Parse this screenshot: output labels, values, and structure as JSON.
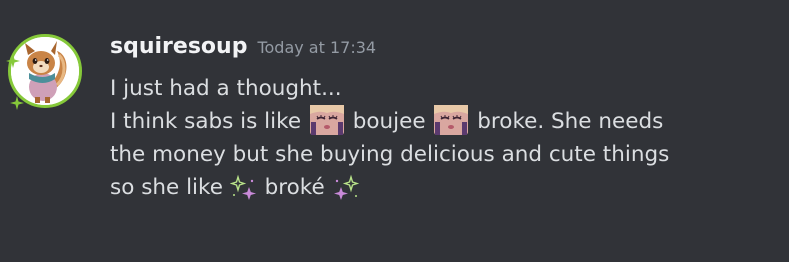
{
  "message": {
    "username": "squiresoup",
    "timestamp": "Today at 17:34",
    "accent_color": "#86c93a",
    "lines": [
      {
        "text": "I just had a thought..."
      },
      {
        "seg1": "I think sabs is like",
        "seg2": "boujee",
        "seg3": "broke. She needs"
      },
      {
        "text": "the money but she buying delicious and cute things"
      },
      {
        "seg1": "so she like",
        "seg2": "broké"
      }
    ],
    "emojis": {
      "face_emoji_1": "crying-face-emoji",
      "face_emoji_2": "crying-face-emoji",
      "sparkle_left": "sparkle-emoji",
      "sparkle_right": "sparkle-emoji"
    }
  }
}
